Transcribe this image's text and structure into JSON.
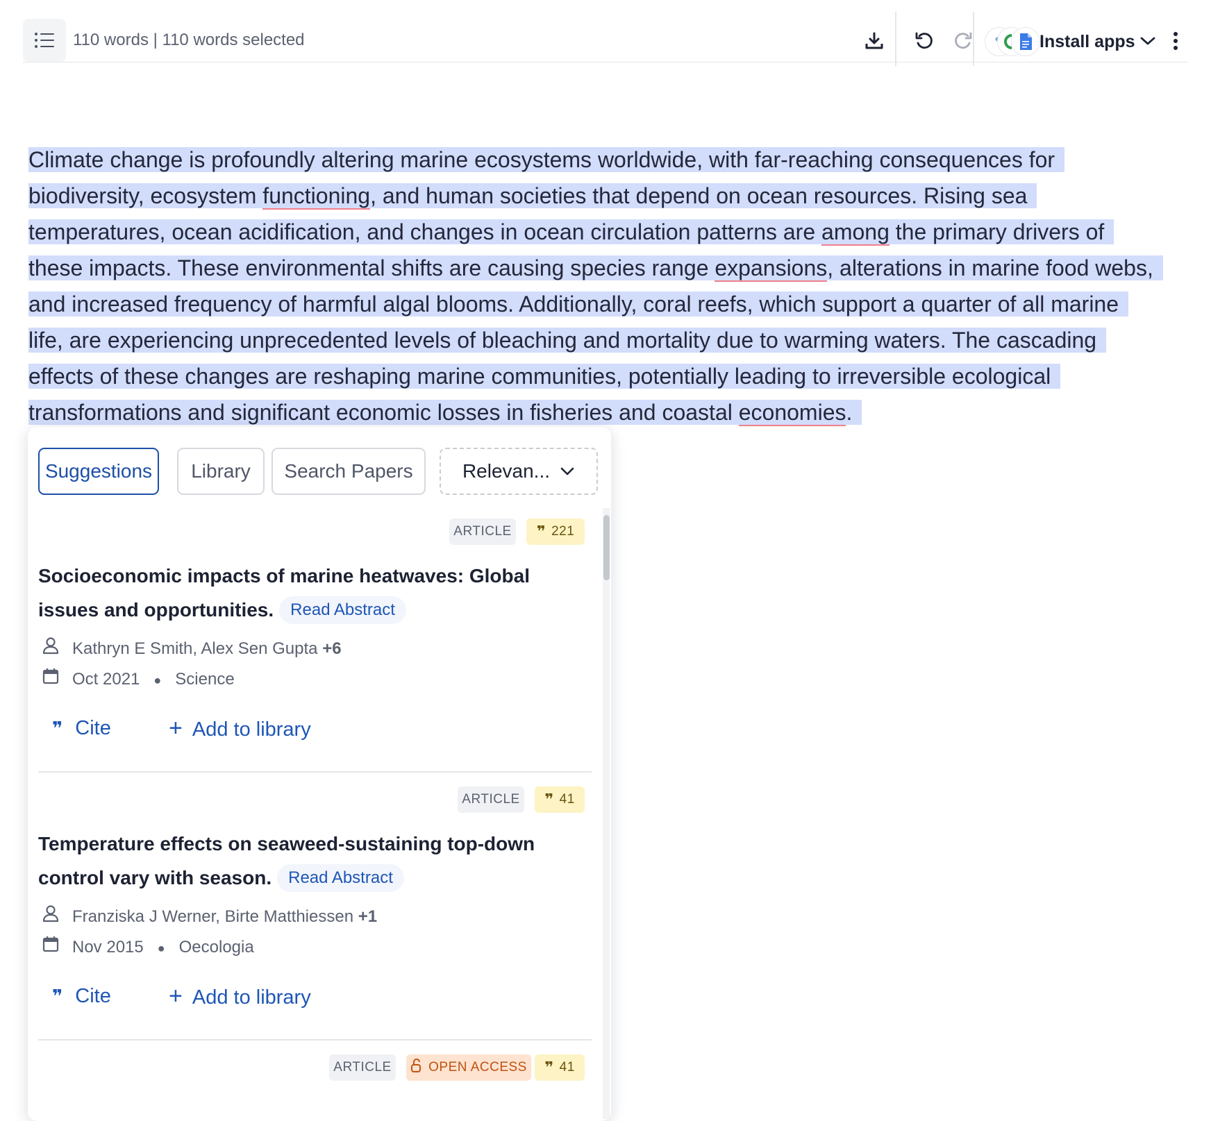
{
  "toolbar": {
    "word_count": "110 words | 110 words selected",
    "install_apps_label": "Install apps",
    "icons": [
      "outline-list-icon",
      "download-icon",
      "undo-icon",
      "redo-icon",
      "chevron-down-icon",
      "more-vertical-icon"
    ]
  },
  "document": {
    "lines": [
      {
        "before": "Climate change is profoundly altering marine ecosystems worldwide, with far-reaching consequences for",
        "mark": "",
        "after": ""
      },
      {
        "before": "biodiversity, ecosystem ",
        "mark": "functioning",
        "after": ", and human societies that depend on ocean resources. Rising sea"
      },
      {
        "before": "temperatures, ocean acidification, and changes in ocean circulation patterns are ",
        "mark": "among",
        "after": " the primary drivers of"
      },
      {
        "before": "these impacts. These environmental shifts are causing species range ",
        "mark": "expansions",
        "after": ", alterations in marine food webs,"
      },
      {
        "before": "and increased frequency of harmful algal blooms. Additionally, coral reefs, which support a quarter of all marine",
        "mark": "",
        "after": ""
      },
      {
        "before": "life, are experiencing unprecedented levels of bleaching and mortality due to warming waters. The cascading",
        "mark": "",
        "after": ""
      },
      {
        "before": "effects of these changes are reshaping marine communities, potentially leading to irreversible ecological",
        "mark": "",
        "after": ""
      },
      {
        "before": "transformations and significant economic losses in fisheries and coastal ",
        "mark": "economies",
        "after": "."
      }
    ],
    "highlight_color": "#d2dcfb",
    "spellcheck_color": "#f07f8c"
  },
  "panel": {
    "tabs": [
      {
        "label": "Suggestions",
        "active": true
      },
      {
        "label": "Library",
        "active": false
      },
      {
        "label": "Search Papers",
        "active": false
      }
    ],
    "sort": {
      "label": "Relevan..."
    },
    "papers": [
      {
        "type": "ARTICLE",
        "citations": "221",
        "title": "Socioeconomic impacts of marine heatwaves: Global issues and opportunities.",
        "read_abstract": "Read Abstract",
        "authors": "Kathryn E Smith, Alex Sen Gupta",
        "more_authors": "+6",
        "date": "Oct 2021",
        "journal": "Science",
        "cite_label": "Cite",
        "add_label": "Add to library"
      },
      {
        "type": "ARTICLE",
        "citations": "41",
        "title": "Temperature effects on seaweed-sustaining top-down control vary with season.",
        "read_abstract": "Read Abstract",
        "authors": "Franziska J Werner, Birte Matthiessen",
        "more_authors": "+1",
        "date": "Nov 2015",
        "journal": "Oecologia",
        "cite_label": "Cite",
        "add_label": "Add to library"
      },
      {
        "type": "ARTICLE",
        "open_access": "OPEN ACCESS",
        "citations": "41"
      }
    ],
    "accent_color": "#1d56b6"
  }
}
